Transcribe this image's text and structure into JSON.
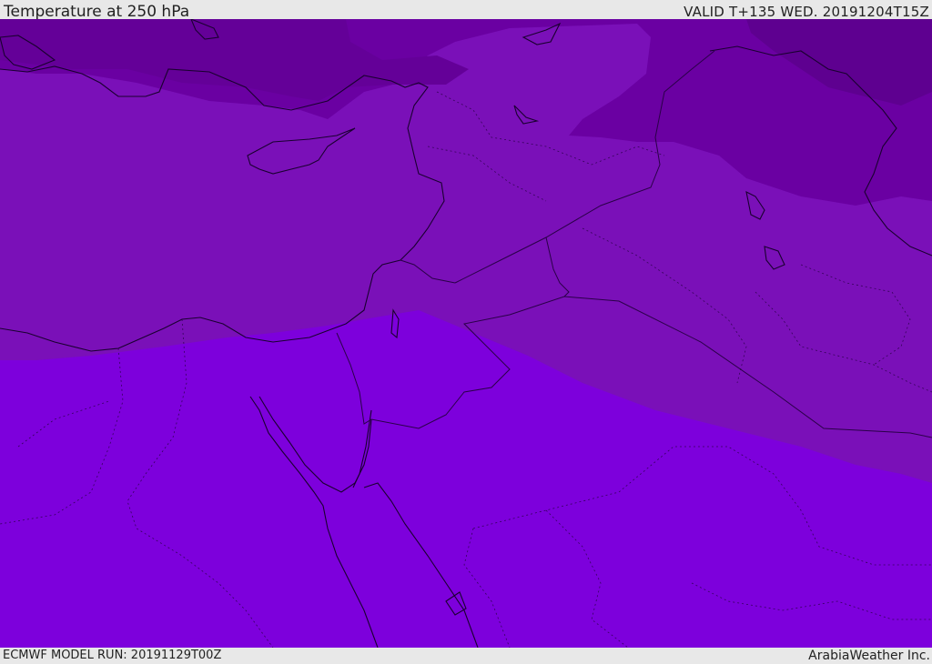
{
  "header": {
    "title": "Temperature at 250 hPa",
    "valid": "VALID T+135 WED. 20191204T15Z"
  },
  "footer": {
    "model_run": "ECMWF MODEL RUN: 20191129T00Z",
    "credit": "ArabiaWeather Inc."
  },
  "map": {
    "field": "temperature_250hPa",
    "colors": {
      "band_darkest": "#5e0090",
      "band_dark": "#6a00a2",
      "band_mid": "#7a10b8",
      "band_light": "#7d00dc",
      "coast": "#1a0030",
      "border": "#2a0048"
    }
  }
}
